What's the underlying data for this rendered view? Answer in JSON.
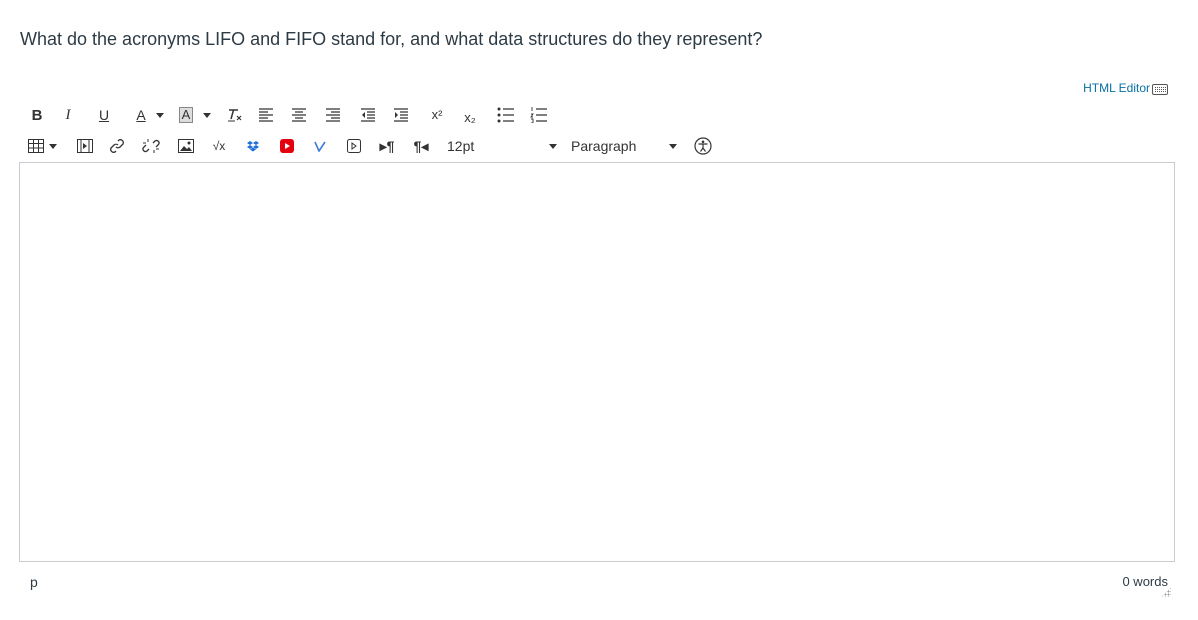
{
  "question": {
    "text": "What do the acronyms LIFO and FIFO stand for, and what data structures do they represent?"
  },
  "html_editor": {
    "label": "HTML Editor",
    "icon": "keyboard-icon"
  },
  "toolbar": {
    "bold_label": "B",
    "italic_label": "I",
    "underline_label": "U",
    "text_color_label": "A",
    "bg_color_label": "A",
    "superscript_label": "x²",
    "subscript_label": "x₂",
    "font_size_value": "12pt",
    "block_format_value": "Paragraph",
    "icons": [
      "bold-icon",
      "italic-icon",
      "underline-icon",
      "text-color-icon",
      "background-color-icon",
      "clear-formatting-icon",
      "align-left-icon",
      "align-center-icon",
      "align-right-icon",
      "outdent-icon",
      "indent-icon",
      "superscript-icon",
      "subscript-icon",
      "bullet-list-icon",
      "numbered-list-icon",
      "table-icon",
      "media-icon",
      "link-icon",
      "unlink-icon",
      "image-icon",
      "math-icon",
      "dropbox-icon",
      "youtube-icon",
      "vimeo-icon",
      "embed-icon",
      "ltr-icon",
      "rtl-icon",
      "accessibility-icon"
    ]
  },
  "status_bar": {
    "path": "p",
    "word_count": "0 words"
  },
  "colors": {
    "link": "#0770a3",
    "text": "#2d3b45",
    "border": "#c7cdd1"
  }
}
